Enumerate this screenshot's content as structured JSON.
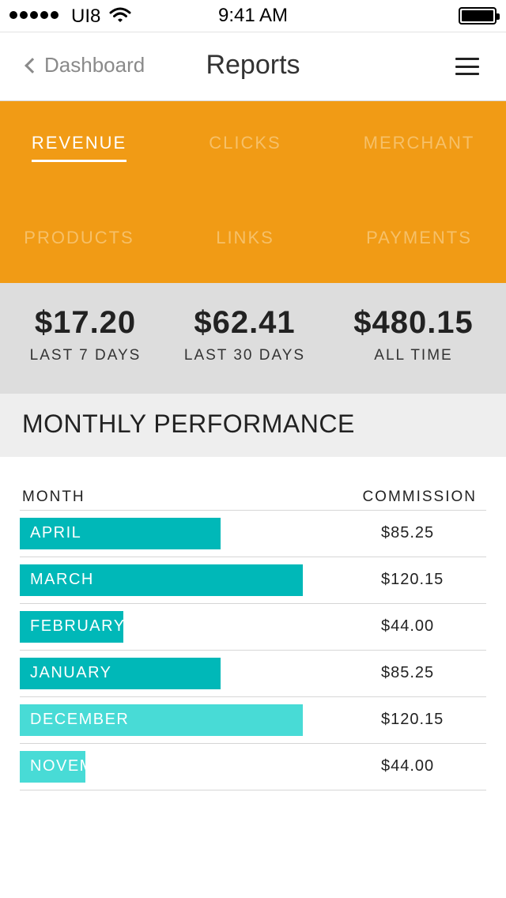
{
  "status_bar": {
    "carrier": "UI8",
    "time": "9:41 AM",
    "signal_icon": "signal-dots-icon",
    "wifi_icon": "wifi-icon",
    "battery_icon": "battery-icon",
    "battery_level": 1.0
  },
  "nav": {
    "back_label": "Dashboard",
    "title": "Reports",
    "menu_icon": "hamburger-menu-icon"
  },
  "tabs": [
    {
      "label": "REVENUE",
      "active": true
    },
    {
      "label": "CLICKS",
      "active": false
    },
    {
      "label": "MERCHANT",
      "active": false
    },
    {
      "label": "PRODUCTS",
      "active": false
    },
    {
      "label": "LINKS",
      "active": false
    },
    {
      "label": "PAYMENTS",
      "active": false
    }
  ],
  "stats": [
    {
      "value": "$17.20",
      "label": "LAST 7 DAYS"
    },
    {
      "value": "$62.41",
      "label": "LAST 30 DAYS"
    },
    {
      "value": "$480.15",
      "label": "ALL TIME"
    }
  ],
  "section_title": "MONTHLY PERFORMANCE",
  "table": {
    "col_month": "MONTH",
    "col_commission": "COMMISSION",
    "rows": [
      {
        "month": "APRIL",
        "commission": "$85.25",
        "value": 85.25,
        "color": "#00b8b8"
      },
      {
        "month": "MARCH",
        "commission": "$120.15",
        "value": 120.15,
        "color": "#00b8b8"
      },
      {
        "month": "FEBRUARY",
        "commission": "$44.00",
        "value": 44.0,
        "color": "#00b8b8"
      },
      {
        "month": "JANUARY",
        "commission": "$85.25",
        "value": 85.25,
        "color": "#00b8b8"
      },
      {
        "month": "DECEMBER",
        "commission": "$120.15",
        "value": 120.15,
        "color": "#48dbd6"
      },
      {
        "month": "NOVEMBER",
        "commission": "$44.00",
        "value": 28.0,
        "color": "#48dbd6"
      }
    ]
  },
  "colors": {
    "accent_orange": "#f19b15",
    "inactive_tab_text": "#f6c068",
    "bar_teal": "#00b8b8",
    "bar_light_teal": "#48dbd6",
    "stats_bg": "#dddddd",
    "section_bg": "#eeeeee"
  }
}
